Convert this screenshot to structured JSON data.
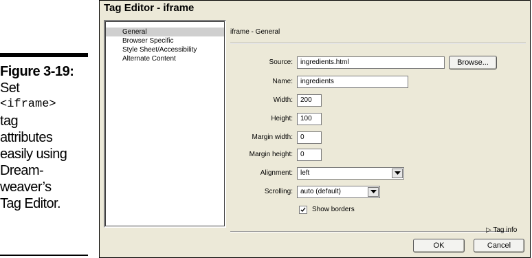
{
  "caption": {
    "figure": "Figure 3-19:",
    "lines": [
      "Set",
      "<iframe>",
      "tag",
      "attributes",
      "easily using",
      "Dream-",
      "weaver’s",
      "Tag Editor."
    ]
  },
  "dialog": {
    "title": "Tag Editor - iframe",
    "categories": [
      "General",
      "Browser Specific",
      "Style Sheet/Accessibility",
      "Alternate Content"
    ],
    "selected_category": "General",
    "panel_title": "iframe - General",
    "fields": {
      "source": {
        "label": "Source:",
        "value": "ingredients.html"
      },
      "name": {
        "label": "Name:",
        "value": "ingredients"
      },
      "width": {
        "label": "Width:",
        "value": "200"
      },
      "height": {
        "label": "Height:",
        "value": "100"
      },
      "margin_width": {
        "label": "Margin width:",
        "value": "0"
      },
      "margin_height": {
        "label": "Margin height:",
        "value": "0"
      },
      "alignment": {
        "label": "Alignment:",
        "value": "left"
      },
      "scrolling": {
        "label": "Scrolling:",
        "value": "auto (default)"
      }
    },
    "show_borders": {
      "label": "Show borders",
      "checked": true
    },
    "browse_label": "Browse...",
    "tag_info_label": "Tag info",
    "ok_label": "OK",
    "cancel_label": "Cancel"
  }
}
